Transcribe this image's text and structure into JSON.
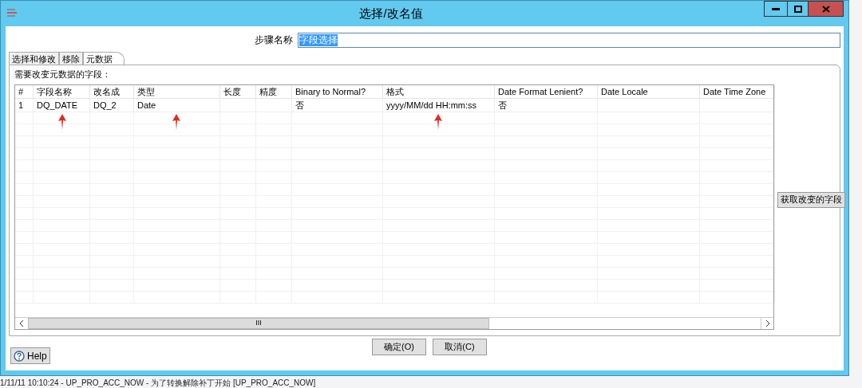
{
  "window": {
    "title": "选择/改名值"
  },
  "step_name": {
    "label": "步骤名称",
    "value": "字段选择"
  },
  "tabs": [
    {
      "label": "选择和修改",
      "selected": false
    },
    {
      "label": "移除",
      "selected": false
    },
    {
      "label": "元数据",
      "selected": true
    }
  ],
  "section_label": "需要改变元数据的字段：",
  "table": {
    "columns": [
      "#",
      "字段名称",
      "改名成",
      "类型",
      "长度",
      "精度",
      "Binary to Normal?",
      "格式",
      "Date Format Lenient?",
      "Date Locale",
      "Date Time Zone"
    ],
    "rows": [
      [
        "1",
        "DQ_DATE",
        "DQ_2",
        "Date",
        "",
        "",
        "否",
        "yyyy/MM/dd HH:mm:ss",
        "否",
        "",
        ""
      ]
    ],
    "scroll_thumb": "III"
  },
  "side_button": "获取改变的字段",
  "help_button": "Help",
  "buttons": [
    "确定(O)",
    "取消(C)"
  ],
  "annotations": [
    {
      "kind": "arrow"
    },
    {
      "kind": "arrow"
    },
    {
      "kind": "arrow"
    }
  ],
  "background_log": "1/11/11 10:10:24 - UP_PRO_ACC_NOW - 为了转换解除补丁开始 [UP_PRO_ACC_NOW]"
}
